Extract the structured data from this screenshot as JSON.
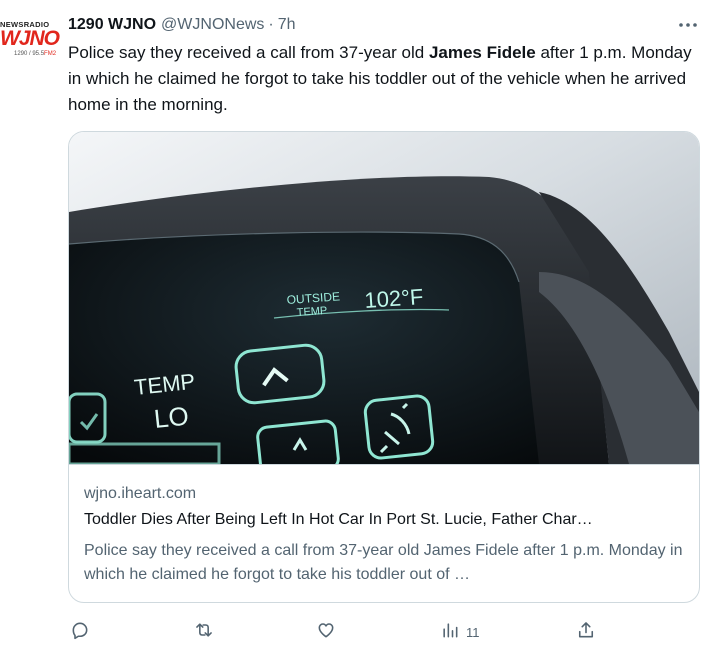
{
  "account": {
    "logo_top": "NEWSRADIO",
    "logo_main": "WJNO",
    "logo_freq": "1290 / 95.5",
    "logo_fm": "FM2",
    "display_name": "1290 WJNO",
    "handle": "@WJNONews",
    "separator": "·",
    "time": "7h"
  },
  "tweet": {
    "text_before": "Police say they received a call from 37-year old ",
    "text_bold": "James Fidele",
    "text_after": " after 1 p.m. Monday in which he claimed he forgot to take his toddler out of the vehicle when he arrived home in the morning."
  },
  "image": {
    "outside_label_1": "OUTSIDE",
    "outside_label_2": "TEMP",
    "temp_value": "102°F",
    "temp_label": "TEMP",
    "temp_setting": "LO"
  },
  "card": {
    "domain": "wjno.iheart.com",
    "title": "Toddler Dies After Being Left In Hot Car In Port St. Lucie, Father Char…",
    "description": "Police say they received a call from 37-year old James Fidele after 1 p.m. Monday in which he claimed he forgot to take his toddler out of …"
  },
  "actions": {
    "views_count": "11"
  },
  "icons": [
    "more-icon",
    "reply-icon",
    "retweet-icon",
    "like-icon",
    "views-icon",
    "share-icon"
  ],
  "colors": {
    "brand_red": "#e1261c",
    "text": "#0f1419",
    "muted": "#536471",
    "border": "#cfd9de",
    "display_glow": "#8fe6d2"
  }
}
